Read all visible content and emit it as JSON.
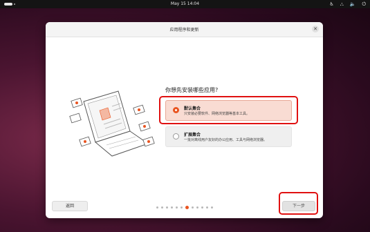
{
  "topbar": {
    "clock": "May 15  14:04",
    "icons": [
      "accessibility-icon",
      "network-icon",
      "volume-icon",
      "power-icon"
    ]
  },
  "dialog": {
    "title": "应用程序和更新",
    "question": "你想先安装哪些应用?",
    "options": [
      {
        "title": "默认集合",
        "description": "只安装必要软件、网络浏览器等基本工具。",
        "selected": true
      },
      {
        "title": "扩展集合",
        "description": "一批对离线用户友好的办公应用、工具与网络浏览器。",
        "selected": false
      }
    ],
    "back_label": "返回",
    "next_label": "下一步",
    "pager": {
      "total": 12,
      "current": 6
    }
  },
  "colors": {
    "accent": "#e95420",
    "highlight": "#e01010",
    "selected_bg": "#f9dcd3"
  }
}
